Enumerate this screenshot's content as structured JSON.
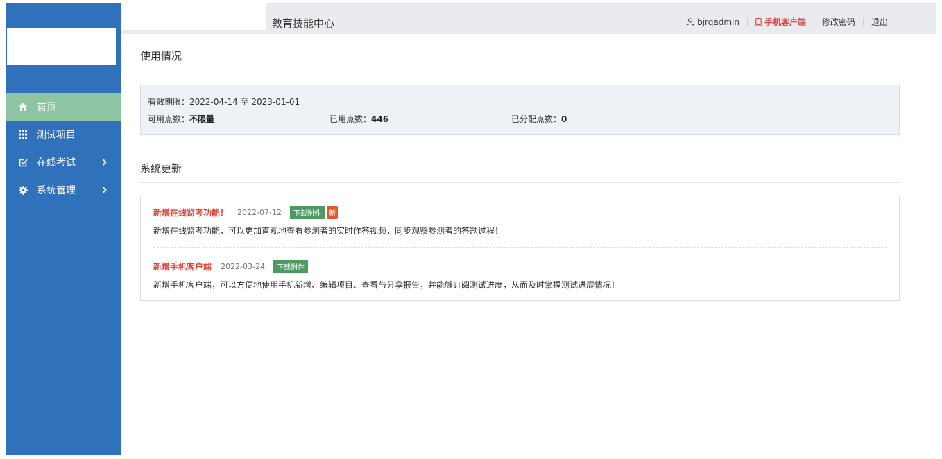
{
  "header": {
    "title": "教育技能中心",
    "username": "bjrqadmin",
    "mobile_label": "手机客户端",
    "change_password_label": "修改密码",
    "logout_label": "退出"
  },
  "sidebar": {
    "items": [
      {
        "label": "首页",
        "icon": "home-icon",
        "active": true
      },
      {
        "label": "测试项目",
        "icon": "grid-icon"
      },
      {
        "label": "在线考试",
        "icon": "checkbox-icon",
        "has_children": true
      },
      {
        "label": "系统管理",
        "icon": "gear-icon",
        "has_children": true
      }
    ]
  },
  "usage": {
    "section_title": "使用情况",
    "validity_label": "有效期限：",
    "validity_value": "2022-04-14 至 2023-01-01",
    "available_label": "可用点数：",
    "available_value": "不限量",
    "used_label": "已用点数：",
    "used_value": "446",
    "allocated_label": "已分配点数：",
    "allocated_value": "0"
  },
  "updates": {
    "section_title": "系统更新",
    "items": [
      {
        "title": "新增在线监考功能！",
        "date": "2022-07-12",
        "download_label": "下载附件",
        "new_label": "新",
        "body": "新增在线监考功能，可以更加直观地查看参测者的实时作答视频，同步观察参测者的答题过程！"
      },
      {
        "title": "新增手机客户端",
        "date": "2022-03-24",
        "download_label": "下载附件",
        "body": "新增手机客户端，可以方便地使用手机新增、编辑项目、查看与分享报告，并能够订阅测试进度，从而及时掌握测试进展情况！"
      }
    ]
  },
  "colors": {
    "sidebar_bg": "#3071bc",
    "active_item": "#8ec4a3",
    "accent_red": "#e2443a",
    "download_badge": "#4e9a63",
    "new_badge": "#e25a2a"
  }
}
